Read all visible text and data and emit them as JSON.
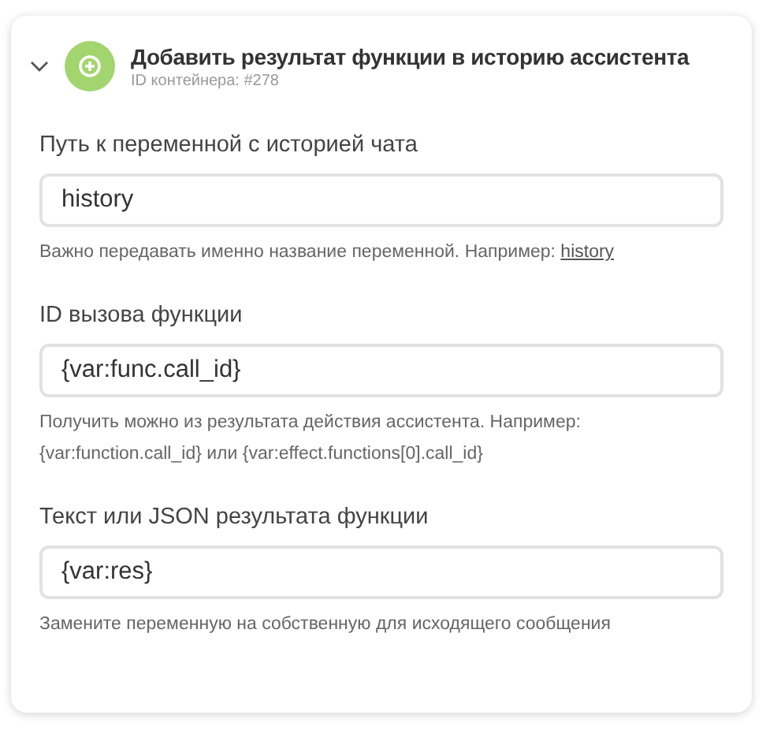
{
  "block": {
    "expanded": true,
    "title": "Добавить результат функции в историю ассистента",
    "subtitle": "ID контейнера: #278"
  },
  "fields": [
    {
      "label": "Путь к переменной с историей чата",
      "value": "history",
      "hint": "Важно передавать именно название переменной. Например: ",
      "hint_link": "history"
    },
    {
      "label": "ID вызова функции",
      "value": "{var:func.call_id}",
      "hint": "Получить можно из результата действия ассистента. Например: {var:function.call_id} или {var:effect.functions[0].call_id}"
    },
    {
      "label": "Текст или JSON результата функции",
      "value": "{var:res}",
      "hint": "Замените переменную на собственную для исходящего сообщения"
    }
  ]
}
